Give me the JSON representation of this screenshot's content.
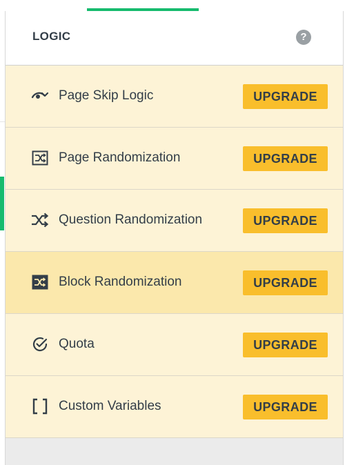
{
  "panel": {
    "title": "LOGIC",
    "help_glyph": "?"
  },
  "rows": [
    {
      "label": "Page Skip Logic",
      "icon": "eye-skip-icon",
      "button": "UPGRADE"
    },
    {
      "label": "Page Randomization",
      "icon": "page-shuffle-icon",
      "button": "UPGRADE"
    },
    {
      "label": "Question Randomization",
      "icon": "shuffle-icon",
      "button": "UPGRADE"
    },
    {
      "label": "Block Randomization",
      "icon": "block-shuffle-icon",
      "button": "UPGRADE"
    },
    {
      "label": "Quota",
      "icon": "check-circle-icon",
      "button": "UPGRADE"
    },
    {
      "label": "Custom Variables",
      "icon": "brackets-icon",
      "button": "UPGRADE"
    }
  ],
  "colors": {
    "accent_green": "#16bb6e",
    "row_bg": "#fdf3d6",
    "row_highlight_bg": "#fbe8ac",
    "upgrade_bg": "#f9be2c"
  }
}
